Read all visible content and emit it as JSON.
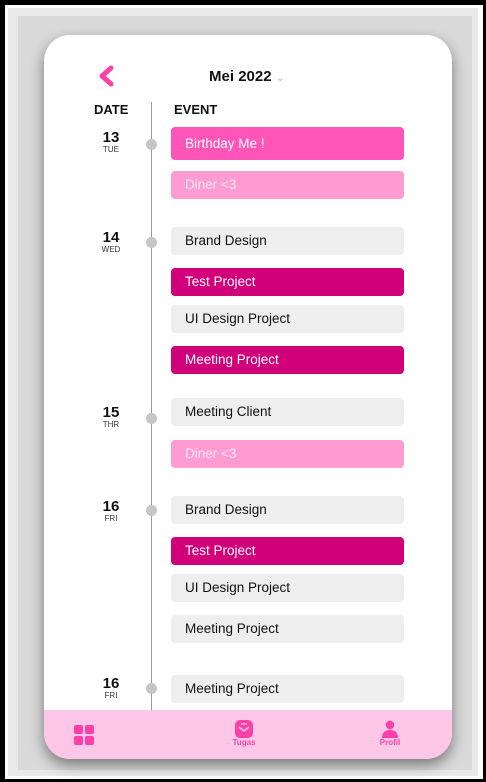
{
  "header": {
    "month": "Mei",
    "year": "2022"
  },
  "columns": {
    "date": "DATE",
    "event": "EVENT"
  },
  "days": [
    {
      "num": "13",
      "weekday": "TUE"
    },
    {
      "num": "14",
      "weekday": "WED"
    },
    {
      "num": "15",
      "weekday": "THR"
    },
    {
      "num": "16",
      "weekday": "FRI"
    },
    {
      "num": "16",
      "weekday": "FRI"
    }
  ],
  "events": [
    {
      "title": "Birthday Me !",
      "style": "pink"
    },
    {
      "title": "Diner <3",
      "style": "light"
    },
    {
      "title": "Brand Design",
      "style": "grey"
    },
    {
      "title": "Test Project",
      "style": "hot"
    },
    {
      "title": "UI Design Project",
      "style": "grey"
    },
    {
      "title": "Meeting Project",
      "style": "hot"
    },
    {
      "title": "Meeting Client",
      "style": "grey"
    },
    {
      "title": "Diner <3",
      "style": "light"
    },
    {
      "title": "Brand Design",
      "style": "grey"
    },
    {
      "title": "Test Project",
      "style": "hot"
    },
    {
      "title": "UI Design Project",
      "style": "grey"
    },
    {
      "title": "Meeting Project",
      "style": "grey"
    },
    {
      "title": "Meeting Project",
      "style": "grey"
    }
  ],
  "nav": {
    "tugas": "Tugas",
    "profil": "Profil"
  },
  "colors": {
    "accent": "#ff3fa8",
    "hot": "#d1007a",
    "pink": "#ff54b8",
    "light": "#ff9bd3",
    "nav_bg": "#ffc7e7"
  },
  "icons": {
    "back": "chevron-left-icon",
    "dropdown": "chevron-down-icon",
    "home": "grid-icon",
    "tasks": "tasks-icon",
    "profile": "user-icon"
  }
}
